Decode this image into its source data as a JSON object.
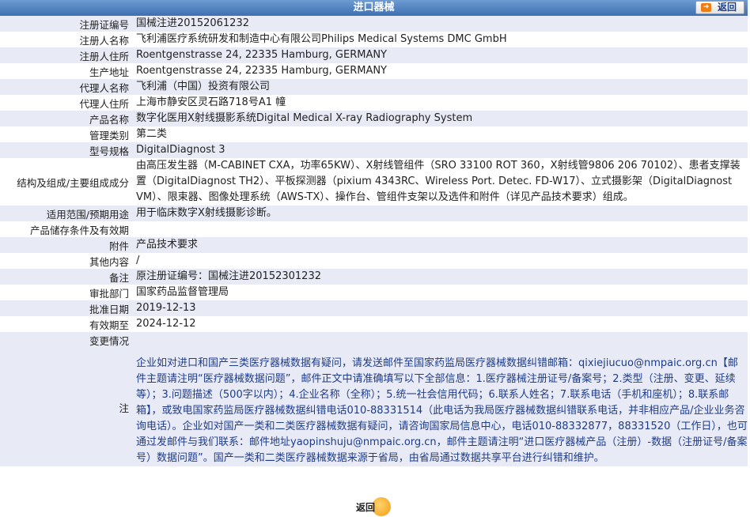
{
  "header": {
    "title": "进口器械",
    "back_label": "返回"
  },
  "rows": [
    {
      "label": "注册证编号",
      "value": "国械注进20152061232"
    },
    {
      "label": "注册人名称",
      "value": "飞利浦医疗系统研发和制造中心有限公司Philips Medical Systems DMC GmbH"
    },
    {
      "label": "注册人住所",
      "value": "Roentgenstrasse 24, 22335 Hamburg, GERMANY"
    },
    {
      "label": "生产地址",
      "value": "Roentgenstrasse 24, 22335 Hamburg, GERMANY"
    },
    {
      "label": "代理人名称",
      "value": "飞利浦（中国）投资有限公司"
    },
    {
      "label": "代理人住所",
      "value": "上海市静安区灵石路718号A1 幢"
    },
    {
      "label": "产品名称",
      "value": "数字化医用X射线摄影系统Digital Medical X-ray Radiography System"
    },
    {
      "label": "管理类别",
      "value": "第二类"
    },
    {
      "label": "型号规格",
      "value": "DigitalDiagnost 3"
    },
    {
      "label": "结构及组成/主要组成成分",
      "value": "由高压发生器（M-CABINET CXA，功率65KW）、X射线管组件（SRO 33100 ROT 360，X射线管9806 206 70102）、患者支撑装置（DigitalDiagnost TH2）、平板探测器（pixium 4343RC、Wireless Port. Detec. FD-W17）、立式摄影架（DigitalDiagnost VM）、限束器、图像处理系统（AWS-TX）、操作台、管组件支架以及选件和附件（详见产品技术要求）组成。"
    },
    {
      "label": "适用范围/预期用途",
      "value": "用于临床数字X射线摄影诊断。"
    },
    {
      "label": "产品储存条件及有效期",
      "value": ""
    },
    {
      "label": "附件",
      "value": "产品技术要求"
    },
    {
      "label": "其他内容",
      "value": "/"
    },
    {
      "label": "备注",
      "value": "原注册证编号：国械注进20152301232"
    },
    {
      "label": "审批部门",
      "value": "国家药品监督管理局"
    },
    {
      "label": "批准日期",
      "value": "2019-12-13"
    },
    {
      "label": "有效期至",
      "value": "2024-12-12"
    },
    {
      "label": "变更情况",
      "value": ""
    }
  ],
  "note": {
    "label": "注",
    "text": "企业如对进口和国产三类医疗器械数据有疑问，请发送邮件至国家药监局医疗器械数据纠错邮箱：qixiejiucuo@nmpaic.org.cn【邮件主题请注明“医疗器械数据问题”，邮件正文中请准确填写以下全部信息：1.医疗器械注册证号/备案号；2.类型（注册、变更、延续等）；3.问题描述（500字以内）；4.企业名称（全称）；5.统一社会信用代码；6.联系人姓名；7.联系电话（手机和座机）；8.联系邮箱】，或致电国家药监局医疗器械数据纠错电话010-88331514（此电话为我局医疗器械数据纠错联系电话，并非相应产品/企业业务咨询电话）。企业如对国产一类和二类医疗器械数据有疑问，请咨询国家局信息中心，电话010-88332877，88331520（工作日），也可通过发邮件与我们联系：邮件地址yaopinshuju@nmpaic.org.cn，邮件主题请注明“进口医疗器械产品（注册）-数据（注册证号/备案号）数据问题”。国产一类和二类医疗器械数据来源于省局，由省局通过数据共享平台进行纠错和维护。"
  },
  "footer": {
    "back_label": "返回"
  }
}
